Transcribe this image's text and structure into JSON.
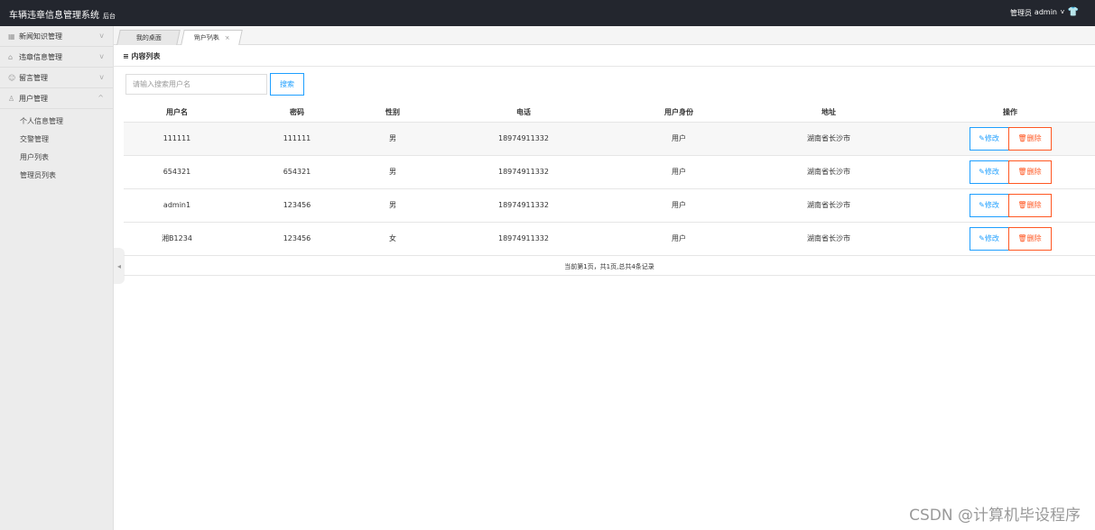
{
  "header": {
    "title": "车辆违章信息管理系统",
    "subtitle": "后台",
    "role": "管理员",
    "username": "admin",
    "caret": "v",
    "shirt_icon": "👕"
  },
  "sidebar": {
    "items": [
      {
        "icon": "▦",
        "label": "新闻知识管理",
        "chev": "v"
      },
      {
        "icon": "⌂",
        "label": "违章信息管理",
        "chev": "v"
      },
      {
        "icon": "☺",
        "label": "留言管理",
        "chev": "v"
      },
      {
        "icon": "♙",
        "label": "用户管理",
        "chev": "^"
      }
    ],
    "subitems": [
      "个人信息管理",
      "交警管理",
      "用户列表",
      "管理员列表"
    ]
  },
  "tabs": {
    "home": "我的桌面",
    "current": "用户列表",
    "close": "×"
  },
  "panel": {
    "title": "≡ 内容列表"
  },
  "search": {
    "placeholder": "请输入搜索用户名",
    "button": "搜索"
  },
  "table": {
    "headers": [
      "用户名",
      "密码",
      "性别",
      "电话",
      "用户身份",
      "地址",
      "操作"
    ],
    "rows": [
      {
        "username": "111111",
        "password": "111111",
        "gender": "男",
        "phone": "18974911332",
        "role": "用户",
        "address": "湖南省长沙市"
      },
      {
        "username": "654321",
        "password": "654321",
        "gender": "男",
        "phone": "18974911332",
        "role": "用户",
        "address": "湖南省长沙市"
      },
      {
        "username": "admin1",
        "password": "123456",
        "gender": "男",
        "phone": "18974911332",
        "role": "用户",
        "address": "湖南省长沙市"
      },
      {
        "username": "湘B1234",
        "password": "123456",
        "gender": "女",
        "phone": "18974911332",
        "role": "用户",
        "address": "湖南省长沙市"
      }
    ],
    "edit_label": "修改",
    "delete_label": "删除",
    "edit_icon": "✎",
    "delete_icon": "🗑"
  },
  "pager": {
    "text": "当前第1页，共1页,总共4条记录"
  },
  "collapse_icon": "◂",
  "watermark": "CSDN @计算机毕设程序"
}
